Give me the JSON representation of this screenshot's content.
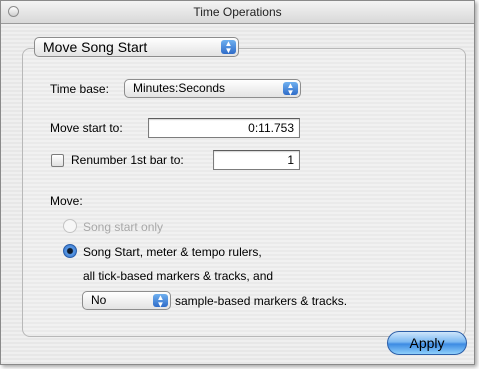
{
  "window": {
    "title": "Time Operations"
  },
  "operation_popup": {
    "selected": "Move Song Start"
  },
  "time_base": {
    "label": "Time base:",
    "selected": "Minutes:Seconds"
  },
  "move_start": {
    "label": "Move start to:",
    "value": "0:11.753"
  },
  "renumber": {
    "label": "Renumber 1st bar to:",
    "value": "1",
    "checked": false
  },
  "move_section": {
    "label": "Move:",
    "option_song_start_only": {
      "label": "Song start only",
      "enabled": false,
      "selected": false
    },
    "option_song_start_meter": {
      "line1": "Song Start, meter & tempo rulers,",
      "line2": "all tick-based markers & tracks, and",
      "selected": true
    },
    "sample_popup": {
      "selected": "No"
    },
    "sample_label": "sample-based markers & tracks."
  },
  "apply_button": {
    "label": "Apply"
  },
  "colors": {
    "accent": "#3d8be3",
    "popup_arrows": "#2f6cc9"
  }
}
